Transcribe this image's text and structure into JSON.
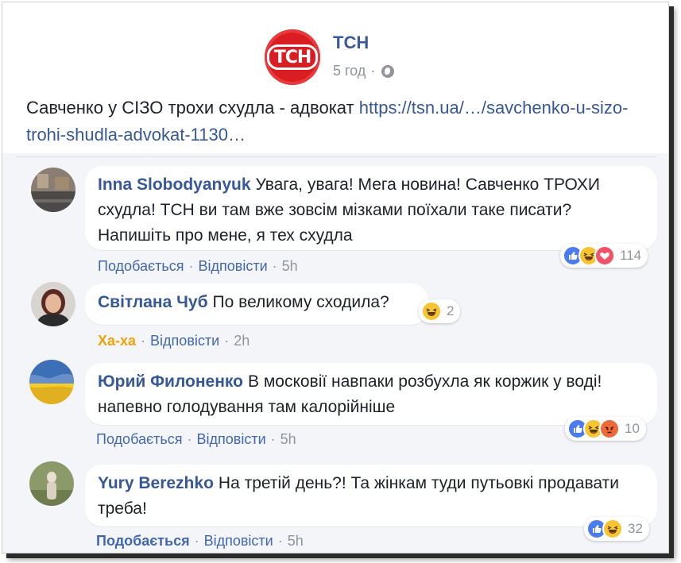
{
  "post": {
    "page_name": "ТСН",
    "time": "5 год",
    "sep": "·",
    "text": "Савченко у СІЗО трохи схудла - адвокат ",
    "link": "https://tsn.ua/…/savchenko-u-sizo-trohi-shudla-advokat-1130…",
    "logo_text": "ТСН"
  },
  "comments": [
    {
      "author": "Inna Slobodyanyuk",
      "text": "Увага, увага! Мега новина! Савченко ТРОХИ схудла! ТСН ви там вже зовсім мізками поїхали таке писати? Напишіть про мене, я тех схудла",
      "like_label": "Подобається",
      "reply_label": "Відповісти",
      "time": "5h",
      "reactions": [
        "like-icon",
        "haha-icon",
        "love-icon"
      ],
      "reaction_count": "114"
    },
    {
      "author": "Світлана Чуб",
      "text": "По великому сходила?",
      "like_label": "Ха-ха",
      "reply_label": "Відповісти",
      "time": "2h",
      "reactions": [
        "haha-icon"
      ],
      "reaction_count": "2"
    },
    {
      "author": "Юрий Филоненко",
      "text": "В московії навпаки розбухла як коржик у воді! напевно голодування там калорійніше",
      "like_label": "Подобається",
      "reply_label": "Відповісти",
      "time": "5h",
      "reactions": [
        "like-icon",
        "haha-icon",
        "angry-icon"
      ],
      "reaction_count": "10"
    },
    {
      "author": "Yury Berezhko",
      "text": "На третій день?! Та жінкам туди путьовкі продавати треба!",
      "like_label": "Подобається",
      "reply_label": "Відповісти",
      "time": "5h",
      "reactions": [
        "like-icon",
        "haha-icon"
      ],
      "reaction_count": "32"
    }
  ],
  "ui": {
    "dot": "·"
  },
  "colors": {
    "brand_blue": "#365899",
    "link_blue": "#4267b2",
    "meta_gray": "#90949c",
    "tsn_red": "#d91d22",
    "haha_yellow": "#f2a20b"
  }
}
